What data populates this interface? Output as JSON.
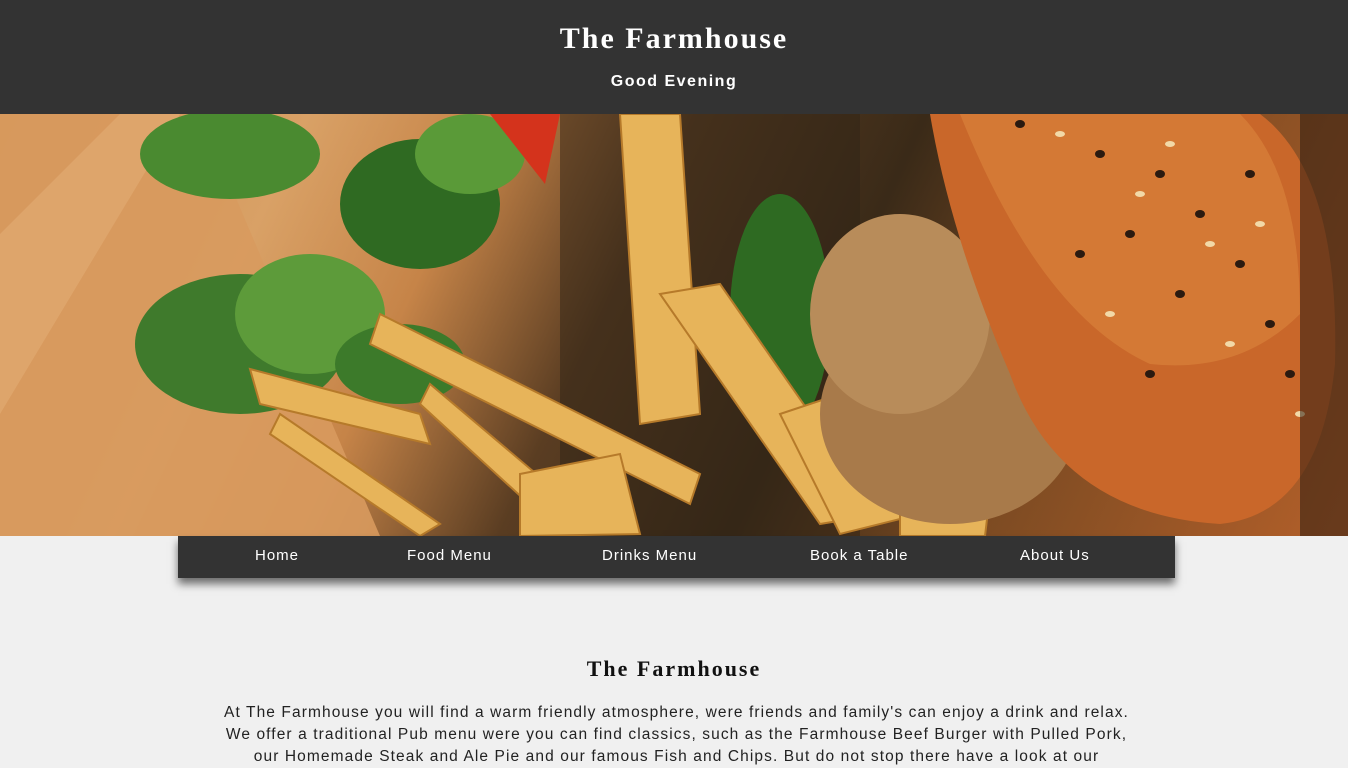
{
  "header": {
    "title": "The Farmhouse",
    "greeting": "Good Evening"
  },
  "hero": {
    "image": "burger-and-chips-photo"
  },
  "nav": {
    "items": [
      {
        "label": "Home"
      },
      {
        "label": "Food Menu"
      },
      {
        "label": "Drinks Menu"
      },
      {
        "label": "Book a Table"
      },
      {
        "label": "About Us"
      }
    ]
  },
  "main": {
    "heading": "The Farmhouse",
    "lines": [
      "At The Farmhouse you will find a warm friendly atmosphere, were friends and family's can enjoy a drink and relax.",
      "We offer a traditional Pub menu were you can find classics, such as the Farmhouse Beef Burger with Pulled Pork,",
      "our Homemade Steak and Ale Pie and our famous Fish and Chips. But do not stop there have a look at our"
    ]
  },
  "colors": {
    "header_bg": "#333333",
    "page_bg": "#f0f0f0",
    "nav_bg": "#333333",
    "text_light": "#ffffff"
  }
}
